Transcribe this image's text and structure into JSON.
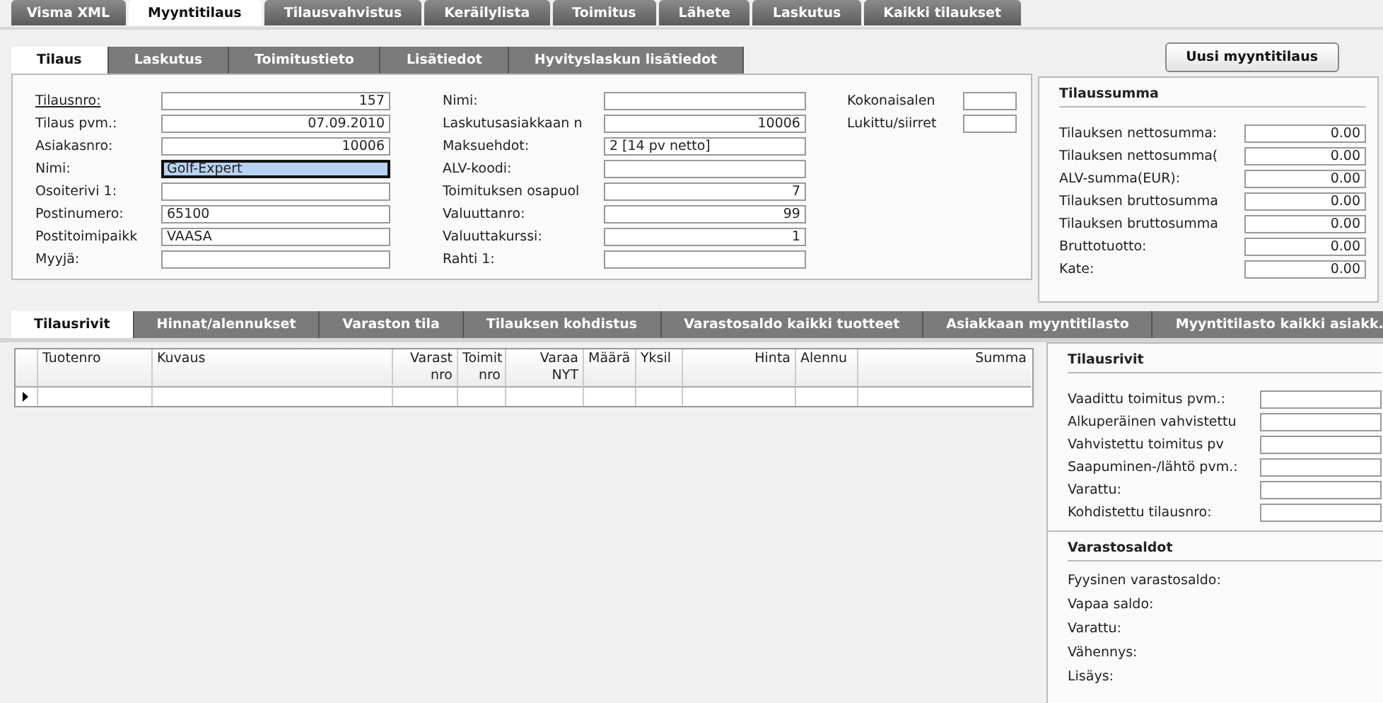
{
  "main_tabs": [
    {
      "label": "Visma XML",
      "selected": false
    },
    {
      "label": "Myyntitilaus",
      "selected": true
    },
    {
      "label": "Tilausvahvistus",
      "selected": false
    },
    {
      "label": "Keräilylista",
      "selected": false
    },
    {
      "label": "Toimitus",
      "selected": false
    },
    {
      "label": "Lähete",
      "selected": false
    },
    {
      "label": "Laskutus",
      "selected": false
    },
    {
      "label": "Kaikki tilaukset",
      "selected": false
    }
  ],
  "new_order_button": "Uusi myyntitilaus",
  "order_tabs": [
    {
      "label": "Tilaus",
      "selected": true
    },
    {
      "label": "Laskutus",
      "selected": false
    },
    {
      "label": "Toimitustieto",
      "selected": false
    },
    {
      "label": "Lisätiedot",
      "selected": false
    },
    {
      "label": "Hyvityslaskun lisätiedot",
      "selected": false
    }
  ],
  "order_form": {
    "columns": [
      [
        {
          "label": "Tilausnro:",
          "value": "157",
          "kind": "number",
          "linked": true,
          "focused": false
        },
        {
          "label": "Tilaus pvm.:",
          "value": "07.09.2010",
          "kind": "number",
          "linked": false,
          "focused": false
        },
        {
          "label": "Asiakasnro:",
          "value": "10006",
          "kind": "number",
          "linked": false,
          "focused": false
        },
        {
          "label": "Nimi:",
          "value": "Golf-Expert",
          "kind": "text",
          "linked": false,
          "focused": true
        },
        {
          "label": "Osoiterivi 1:",
          "kind": "text",
          "linked": false,
          "focused": false
        },
        {
          "label": "Postinumero:",
          "value": "65100",
          "kind": "text",
          "linked": false,
          "focused": false
        },
        {
          "label": "Postitoimipaikk",
          "value": "VAASA",
          "kind": "text",
          "linked": false,
          "focused": false
        },
        {
          "label": "Myyjä:",
          "kind": "text",
          "linked": false,
          "focused": false
        }
      ],
      [
        {
          "label": "Nimi:",
          "kind": "text",
          "linked": false,
          "focused": false
        },
        {
          "label": "Laskutusasiakkaan n",
          "value": "10006",
          "kind": "number",
          "linked": false,
          "focused": false
        },
        {
          "label": "Maksuehdot:",
          "value": "2 [14 pv netto]",
          "kind": "text",
          "linked": false,
          "focused": false
        },
        {
          "label": "ALV-koodi:",
          "kind": "text",
          "linked": false,
          "focused": false
        },
        {
          "label": "Toimituksen osapuol",
          "value": "7",
          "kind": "number",
          "linked": false,
          "focused": false
        },
        {
          "label": "Valuuttanro:",
          "value": "99",
          "kind": "number",
          "linked": false,
          "focused": false
        },
        {
          "label": "Valuuttakurssi:",
          "value": "1",
          "kind": "number",
          "linked": false,
          "focused": false
        },
        {
          "label": "Rahti 1:",
          "kind": "text",
          "linked": false,
          "focused": false
        }
      ],
      [
        {
          "label": "Kokonaisalen",
          "kind": "text",
          "linked": false,
          "focused": false
        },
        {
          "label": "Lukittu/siirret",
          "kind": "text",
          "linked": false,
          "focused": false
        }
      ]
    ]
  },
  "totals": {
    "title": "Tilaussumma",
    "fields": [
      {
        "label": "Tilauksen nettosumma:",
        "value": "0.00"
      },
      {
        "label": "Tilauksen nettosumma(",
        "value": "0.00"
      },
      {
        "label": "ALV-summa(EUR):",
        "value": "0.00"
      },
      {
        "label": "Tilauksen bruttosumma",
        "value": "0.00"
      },
      {
        "label": "Tilauksen bruttosumma",
        "value": "0.00"
      },
      {
        "label": "Bruttotuotto:",
        "value": "0.00"
      },
      {
        "label": "Kate:",
        "value": "0.00"
      }
    ]
  },
  "line_tabs": [
    {
      "label": "Tilausrivit",
      "selected": true
    },
    {
      "label": "Hinnat/alennukset",
      "selected": false
    },
    {
      "label": "Varaston tila",
      "selected": false
    },
    {
      "label": "Tilauksen kohdistus",
      "selected": false
    },
    {
      "label": "Varastosaldo kaikki tuotteet",
      "selected": false
    },
    {
      "label": "Asiakkaan myyntitilasto",
      "selected": false
    },
    {
      "label": "Myyntitilasto kaikki asiakk.",
      "selected": false
    }
  ],
  "grid": {
    "columns": [
      {
        "label": "Tuotenro",
        "kind": "text"
      },
      {
        "label": "Kuvaus",
        "kind": "text"
      },
      {
        "label": "Varast\nnro",
        "kind": "number"
      },
      {
        "label": "Toimit\nnro",
        "kind": "number"
      },
      {
        "label": "Varaa\nNYT",
        "kind": "number"
      },
      {
        "label": "Määrä",
        "kind": "text"
      },
      {
        "label": "Yksil",
        "kind": "text"
      },
      {
        "label": "Hinta",
        "kind": "number"
      },
      {
        "label": "Alennu",
        "kind": "text"
      },
      {
        "label": "Summa",
        "kind": "number"
      }
    ],
    "rows": [
      {
        "current": true
      }
    ]
  },
  "line_details": {
    "title": "Tilausrivit",
    "fields": [
      {
        "label": "Vaadittu toimitus pvm.:"
      },
      {
        "label": "Alkuperäinen vahvistettu"
      },
      {
        "label": "Vahvistettu toimitus pv"
      },
      {
        "label": "Saapuminen-/lähtö pvm.:"
      },
      {
        "label": "Varattu:"
      },
      {
        "label": "Kohdistettu tilausnro:"
      }
    ]
  },
  "stock": {
    "title": "Varastosaldot",
    "labels": [
      "Fyysinen varastosaldo:",
      "Vapaa saldo:",
      "Varattu:",
      "Vähennys:",
      "Lisäys:"
    ]
  }
}
